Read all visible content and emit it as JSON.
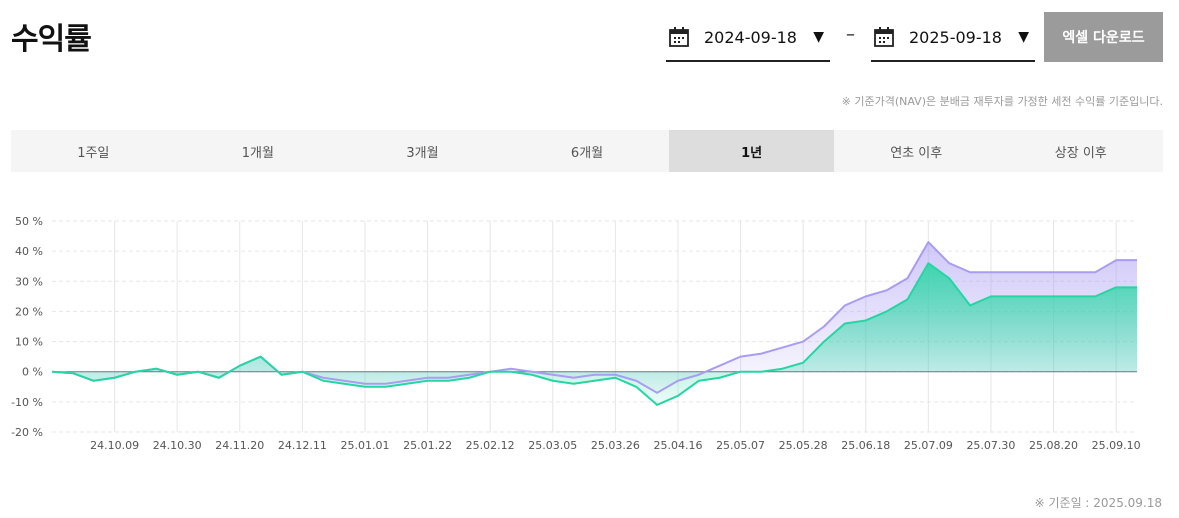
{
  "header": {
    "title": "수익률"
  },
  "date_range": {
    "start": "2024-09-18",
    "separator": "–",
    "end": "2025-09-18",
    "arrow": "▼"
  },
  "toolbar": {
    "excel_label": "엑셀 다운로드"
  },
  "note": "※ 기준가격(NAV)은 분배금 재투자를 가정한 세전 수익률 기준입니다.",
  "tabs": [
    {
      "label": "1주일"
    },
    {
      "label": "1개월"
    },
    {
      "label": "3개월"
    },
    {
      "label": "6개월"
    },
    {
      "label": "1년",
      "active": true
    },
    {
      "label": "연초 이후"
    },
    {
      "label": "상장 이후"
    }
  ],
  "footnote": "※ 기준일 : 2025.09.18",
  "chart_data": {
    "type": "area",
    "y_unit": "%",
    "ylim": [
      -20,
      50
    ],
    "y_ticks": [
      50,
      40,
      30,
      20,
      10,
      0,
      -10,
      -20
    ],
    "y_tick_labels": [
      "50 %",
      "40 %",
      "30 %",
      "20 %",
      "10 %",
      "0 %",
      "-10 %",
      "-20 %"
    ],
    "x_tick_labels": [
      "24.10.09",
      "24.10.30",
      "24.11.20",
      "24.12.11",
      "25.01.01",
      "25.01.22",
      "25.02.12",
      "25.03.05",
      "25.03.26",
      "25.04.16",
      "25.05.07",
      "25.05.28",
      "25.06.18",
      "25.07.09",
      "25.07.30",
      "25.08.20",
      "25.09.10"
    ],
    "grid": true,
    "colors": {
      "series_a": "#a99cf2",
      "series_b": "#25d6a3",
      "zero_line": "#6b7a86",
      "grid": "#e6e6ea"
    },
    "x": [
      "24.09.18",
      "24.09.25",
      "24.10.02",
      "24.10.09",
      "24.10.16",
      "24.10.23",
      "24.10.30",
      "24.11.06",
      "24.11.13",
      "24.11.20",
      "24.11.27",
      "24.12.04",
      "24.12.11",
      "24.12.18",
      "24.12.25",
      "25.01.01",
      "25.01.08",
      "25.01.15",
      "25.01.22",
      "25.01.29",
      "25.02.05",
      "25.02.12",
      "25.02.19",
      "25.02.26",
      "25.03.05",
      "25.03.12",
      "25.03.19",
      "25.03.26",
      "25.04.02",
      "25.04.09",
      "25.04.16",
      "25.04.23",
      "25.04.30",
      "25.05.07",
      "25.05.14",
      "25.05.21",
      "25.05.28",
      "25.06.04",
      "25.06.11",
      "25.06.18",
      "25.06.25",
      "25.07.02",
      "25.07.09",
      "25.07.16",
      "25.07.23",
      "25.07.30",
      "25.08.06",
      "25.08.13",
      "25.08.20",
      "25.08.27",
      "25.09.03",
      "25.09.10",
      "25.09.18"
    ],
    "series": [
      {
        "values": [
          0,
          -0.5,
          -3,
          -2,
          0,
          1,
          -1,
          0,
          -2,
          2,
          5,
          -1,
          0,
          -2,
          -3,
          -4,
          -4,
          -3,
          -2,
          -2,
          -1,
          0,
          1,
          0,
          -1,
          -2,
          -1,
          -1,
          -3,
          -7,
          -3,
          -1,
          2,
          5,
          6,
          8,
          10,
          15,
          22,
          25,
          27,
          31,
          43,
          36,
          33,
          33,
          33,
          33,
          33,
          33,
          33,
          37,
          37
        ]
      },
      {
        "values": [
          0,
          -0.5,
          -3,
          -2,
          0,
          1,
          -1,
          0,
          -2,
          2,
          5,
          -1,
          0,
          -3,
          -4,
          -5,
          -5,
          -4,
          -3,
          -3,
          -2,
          0,
          0,
          -1,
          -3,
          -4,
          -3,
          -2,
          -5,
          -11,
          -8,
          -3,
          -2,
          0,
          0,
          1,
          3,
          10,
          16,
          17,
          20,
          24,
          36,
          31,
          22,
          25,
          25,
          25,
          25,
          25,
          25,
          28,
          28
        ]
      }
    ]
  }
}
